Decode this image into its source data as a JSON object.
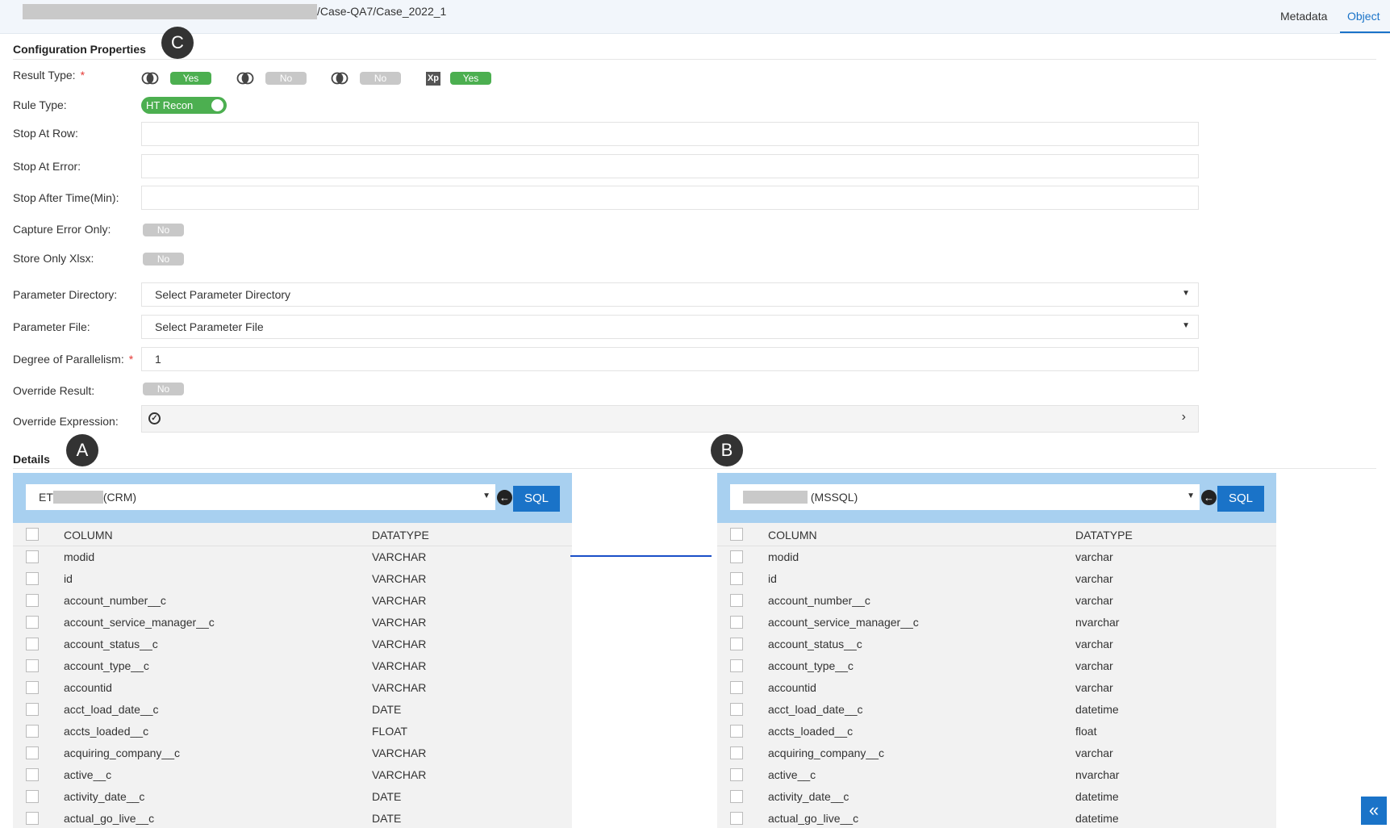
{
  "breadcrumb": {
    "path": "/Case-QA7/Case_2022_1"
  },
  "tabs": [
    {
      "label": "Metadata"
    },
    {
      "label": "Object"
    }
  ],
  "markers": {
    "a": "A",
    "b": "B",
    "c": "C"
  },
  "config": {
    "title": "Configuration Properties",
    "result_type": {
      "label": "Result Type:",
      "required": "*",
      "values": [
        "Yes",
        "No",
        "No",
        "Yes"
      ],
      "xp_icon_text": "Xp"
    },
    "rule_type": {
      "label": "Rule Type:",
      "value": "HT Recon"
    },
    "stop_at_row": {
      "label": "Stop At Row:",
      "value": ""
    },
    "stop_at_error": {
      "label": "Stop At Error:",
      "value": ""
    },
    "stop_after_time": {
      "label": "Stop After Time(Min):",
      "value": ""
    },
    "capture_error_only": {
      "label": "Capture Error Only:",
      "value": "No"
    },
    "store_only_xlsx": {
      "label": "Store Only Xlsx:",
      "value": "No"
    },
    "parameter_directory": {
      "label": "Parameter Directory:",
      "placeholder": "Select Parameter Directory"
    },
    "parameter_file": {
      "label": "Parameter File:",
      "placeholder": "Select Parameter File"
    },
    "degree_of_parallelism": {
      "label": "Degree of Parallelism:",
      "required": "*",
      "value": "1"
    },
    "override_result": {
      "label": "Override Result:",
      "value": "No"
    },
    "override_expression": {
      "label": "Override Expression:"
    }
  },
  "details": {
    "title": "Details",
    "left": {
      "source_prefix": "ET",
      "source_suffix": "(CRM)",
      "sql_label": "SQL",
      "col_header": "COLUMN",
      "type_header": "DATATYPE",
      "rows": [
        [
          "modid",
          "VARCHAR"
        ],
        [
          "id",
          "VARCHAR"
        ],
        [
          "account_number__c",
          "VARCHAR"
        ],
        [
          "account_service_manager__c",
          "VARCHAR"
        ],
        [
          "account_status__c",
          "VARCHAR"
        ],
        [
          "account_type__c",
          "VARCHAR"
        ],
        [
          "accountid",
          "VARCHAR"
        ],
        [
          "acct_load_date__c",
          "DATE"
        ],
        [
          "accts_loaded__c",
          "FLOAT"
        ],
        [
          "acquiring_company__c",
          "VARCHAR"
        ],
        [
          "active__c",
          "VARCHAR"
        ],
        [
          "activity_date__c",
          "DATE"
        ],
        [
          "actual_go_live__c",
          "DATE"
        ]
      ]
    },
    "right": {
      "source_prefix": "",
      "source_suffix": "(MSSQL)",
      "sql_label": "SQL",
      "col_header": "COLUMN",
      "type_header": "DATATYPE",
      "rows": [
        [
          "modid",
          "varchar"
        ],
        [
          "id",
          "varchar"
        ],
        [
          "account_number__c",
          "varchar"
        ],
        [
          "account_service_manager__c",
          "nvarchar"
        ],
        [
          "account_status__c",
          "varchar"
        ],
        [
          "account_type__c",
          "varchar"
        ],
        [
          "accountid",
          "varchar"
        ],
        [
          "acct_load_date__c",
          "datetime"
        ],
        [
          "accts_loaded__c",
          "float"
        ],
        [
          "acquiring_company__c",
          "varchar"
        ],
        [
          "active__c",
          "nvarchar"
        ],
        [
          "activity_date__c",
          "datetime"
        ],
        [
          "actual_go_live__c",
          "datetime"
        ]
      ]
    }
  },
  "icons": {
    "collapse": "double-chevron-left-icon",
    "back": "arrow-left-circle-icon",
    "override_expr": "check-circle-icon",
    "expand": "chevron-right-icon"
  },
  "colors": {
    "accent": "#1a73c8",
    "on": "#4caf50",
    "off": "#c8c8c8",
    "panel_head": "#a8d0f0"
  }
}
